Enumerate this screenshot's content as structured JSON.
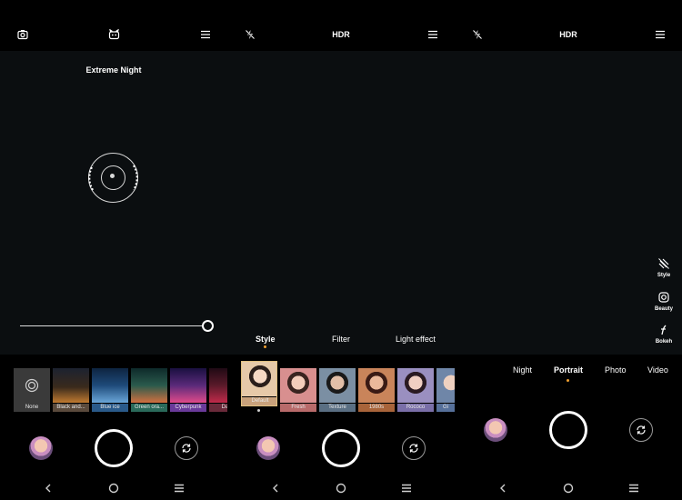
{
  "panel1": {
    "top_icons": [
      "camera-settings-icon",
      "night-mode-icon",
      "menu-icon"
    ],
    "mode_label": "Extreme Night",
    "filters": [
      {
        "label": "None",
        "icon": "filter-none-icon"
      },
      {
        "label": "Black and...",
        "color": "#3a2a1c"
      },
      {
        "label": "Blue ice",
        "color": "#1e4a7a"
      },
      {
        "label": "Green ora...",
        "color": "#2a5a4c"
      },
      {
        "label": "Cyberpunk",
        "color": "#5a2a7a"
      },
      {
        "label": "Dark",
        "color": "#5a1a2a"
      }
    ]
  },
  "panel2": {
    "top_center": "HDR",
    "top_icons": [
      "flash-off-icon",
      "menu-icon"
    ],
    "tabs": [
      "Style",
      "Filter",
      "Light effect"
    ],
    "active_tab": "Style",
    "styles": [
      {
        "label": "Default",
        "color": "#e6c9a8"
      },
      {
        "label": "Fresh",
        "color": "#d88f8f"
      },
      {
        "label": "Texture",
        "color": "#7b8fa3"
      },
      {
        "label": "1980s",
        "color": "#c9845a"
      },
      {
        "label": "Rococo",
        "color": "#9a8fc0"
      },
      {
        "label": "Gi",
        "color": "#6f86a8"
      }
    ]
  },
  "panel3": {
    "top_center": "HDR",
    "top_icons": [
      "flash-off-icon",
      "menu-icon"
    ],
    "side_tools": [
      {
        "label": "Style",
        "icon": "style-icon"
      },
      {
        "label": "Beauty",
        "icon": "beauty-icon"
      },
      {
        "label": "Bokeh",
        "icon": "aperture-icon"
      }
    ],
    "modes": [
      "Night",
      "Portrait",
      "Photo",
      "Video"
    ],
    "active_mode": "Portrait"
  },
  "colors": {
    "accent": "#f0a030",
    "viewfinder": "#0b0e10"
  }
}
